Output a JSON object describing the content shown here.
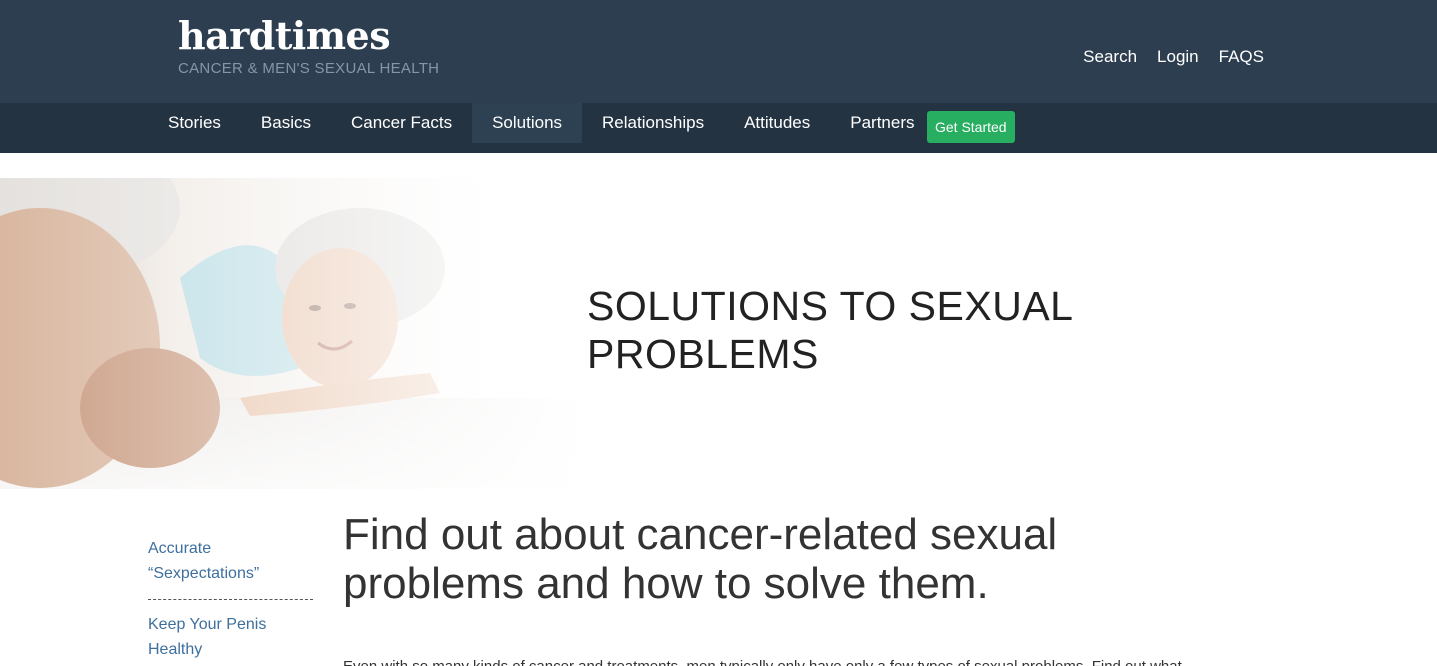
{
  "brand": {
    "name": "hardtimes",
    "tagline": "CANCER & MEN'S SEXUAL HEALTH"
  },
  "util_nav": [
    {
      "label": "Search"
    },
    {
      "label": "Login"
    },
    {
      "label": "FAQS"
    }
  ],
  "main_nav": {
    "items": [
      {
        "label": "Stories"
      },
      {
        "label": "Basics"
      },
      {
        "label": "Cancer Facts"
      },
      {
        "label": "Solutions",
        "active": true
      },
      {
        "label": "Relationships"
      },
      {
        "label": "Attitudes"
      },
      {
        "label": "Partners"
      }
    ],
    "cta_label": "Get Started"
  },
  "hero": {
    "title_line1": "SOLUTIONS TO SEXUAL",
    "title_line2": "PROBLEMS"
  },
  "sidebar": {
    "links": [
      {
        "line1": "Accurate",
        "line2": "“Sexpectations”"
      },
      {
        "line1": "Keep Your Penis",
        "line2": "Healthy"
      }
    ]
  },
  "content": {
    "heading_line1": "Find out about cancer-related sexual",
    "heading_line2": "problems and how to solve them.",
    "intro": "Even with so many kinds of cancer and treatments, men typically only have only a few types of sexual problems. Find out what"
  },
  "colors": {
    "header_bg": "#2c3e50",
    "nav_bg": "#243342",
    "active_tab_bg": "#2e4152",
    "cta_green": "#27ae60",
    "link_blue": "#3e6f9e"
  }
}
